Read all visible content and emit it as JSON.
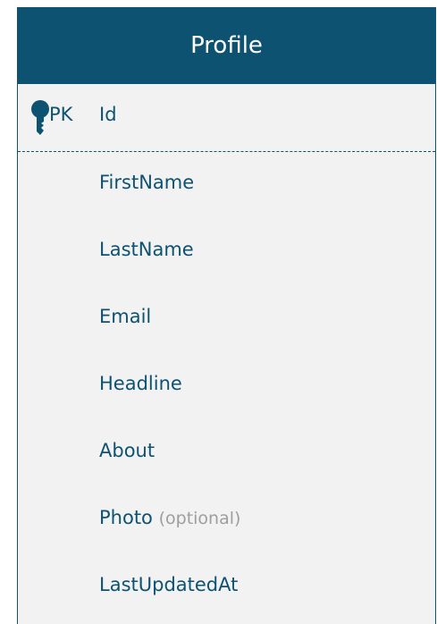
{
  "entity": {
    "title": "Profile",
    "primary_key": {
      "marker": "PK",
      "name": "Id"
    },
    "fields": [
      {
        "name": "FirstName",
        "optional": ""
      },
      {
        "name": "LastName",
        "optional": ""
      },
      {
        "name": "Email",
        "optional": ""
      },
      {
        "name": "Headline",
        "optional": ""
      },
      {
        "name": "About",
        "optional": ""
      },
      {
        "name": "Photo",
        "optional": "(optional)"
      },
      {
        "name": "LastUpdatedAt",
        "optional": ""
      }
    ]
  },
  "colors": {
    "header_bg": "#0e5272",
    "body_bg": "#f2f2f2",
    "text": "#0e5272",
    "optional_text": "#9e9e9e"
  },
  "icons": {
    "primary_key": "key-icon"
  }
}
